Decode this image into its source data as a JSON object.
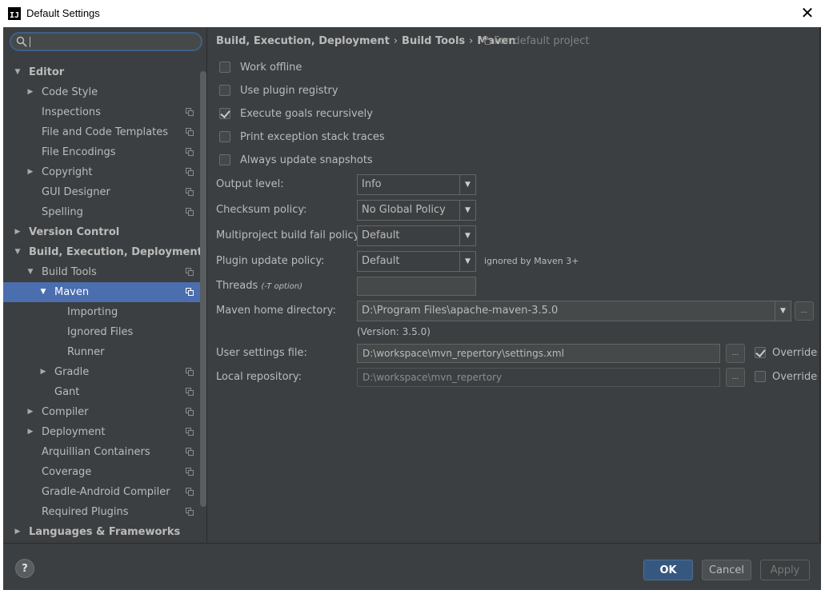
{
  "window": {
    "title": "Default Settings",
    "close_glyph": "✕",
    "icon_letters": "IJ"
  },
  "search": {
    "value": "",
    "placeholder": ""
  },
  "tree": [
    {
      "label": "Editor",
      "expanded": true
    },
    {
      "label": "Code Style"
    },
    {
      "label": "Inspections"
    },
    {
      "label": "File and Code Templates"
    },
    {
      "label": "File Encodings"
    },
    {
      "label": "Copyright"
    },
    {
      "label": "GUI Designer"
    },
    {
      "label": "Spelling"
    },
    {
      "label": "Version Control"
    },
    {
      "label": "Build, Execution, Deployment",
      "expanded": true
    },
    {
      "label": "Build Tools",
      "expanded": true
    },
    {
      "label": "Maven",
      "expanded": true,
      "selected": true
    },
    {
      "label": "Importing"
    },
    {
      "label": "Ignored Files"
    },
    {
      "label": "Runner"
    },
    {
      "label": "Gradle"
    },
    {
      "label": "Gant"
    },
    {
      "label": "Compiler"
    },
    {
      "label": "Deployment"
    },
    {
      "label": "Arquillian Containers"
    },
    {
      "label": "Coverage"
    },
    {
      "label": "Gradle-Android Compiler"
    },
    {
      "label": "Required Plugins"
    },
    {
      "label": "Languages & Frameworks"
    }
  ],
  "breadcrumb": {
    "items": [
      "Build, Execution, Deployment",
      "Build Tools",
      "Maven"
    ],
    "separator": "›",
    "scope": "For default project"
  },
  "checkboxes": [
    {
      "label": "Work offline",
      "checked": false
    },
    {
      "label": "Use plugin registry",
      "checked": false
    },
    {
      "label": "Execute goals recursively",
      "checked": true
    },
    {
      "label": "Print exception stack traces",
      "checked": false
    },
    {
      "label": "Always update snapshots",
      "checked": false
    }
  ],
  "fields": {
    "output_level": {
      "label": "Output level:",
      "value": "Info"
    },
    "checksum_policy": {
      "label": "Checksum policy:",
      "value": "No Global Policy"
    },
    "multiproject_fail": {
      "label": "Multiproject build fail policy:",
      "value": "Default"
    },
    "plugin_update": {
      "label": "Plugin update policy:",
      "value": "Default",
      "hint": "ignored by Maven 3+"
    },
    "threads": {
      "label": "Threads",
      "label_note": "(-T option)",
      "value": ""
    },
    "maven_home": {
      "label": "Maven home directory:",
      "value": "D:\\Program Files\\apache-maven-3.5.0",
      "version": "(Version: 3.5.0)"
    },
    "user_settings": {
      "label": "User settings file:",
      "value": "D:\\workspace\\mvn_repertory\\settings.xml",
      "override_label": "Override",
      "override": true
    },
    "local_repo": {
      "label": "Local repository:",
      "value": "D:\\workspace\\mvn_repertory",
      "override_label": "Override",
      "override": false
    }
  },
  "browse_glyph": "...",
  "dropdown_glyph": "▼",
  "footer": {
    "help_label": "?",
    "ok_label": "OK",
    "cancel_label": "Cancel",
    "apply_label": "Apply"
  },
  "colors": {
    "background": "#3c3f41",
    "selection": "#4b6eaf",
    "primary_button": "#365880",
    "text": "#bbbbbb"
  }
}
